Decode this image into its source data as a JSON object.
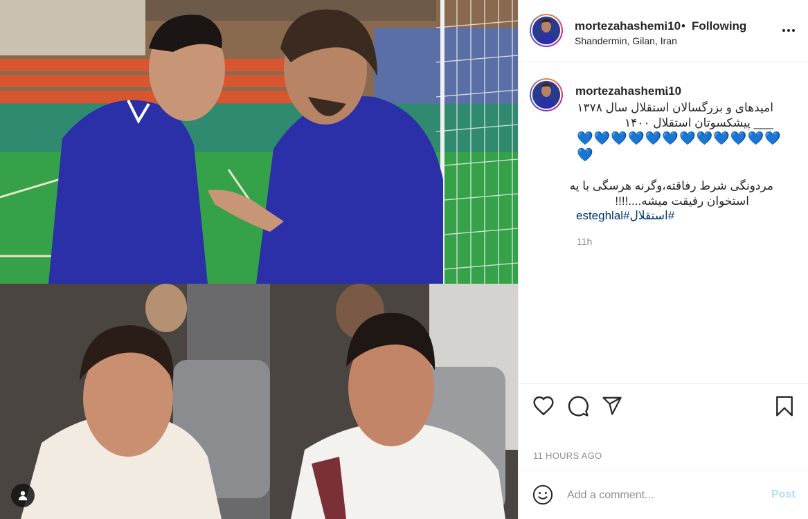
{
  "post": {
    "author": "mortezahashemi10",
    "follow_status": "Following",
    "separator": "•",
    "location": "Shandermin, Gilan, Iran"
  },
  "caption": {
    "username": "mortezahashemi10",
    "suffix": "..",
    "line1": "امیدهای و بزرگسالان استقلال سال ۱۳۷۸",
    "line2": "___ پیشکسوتان استقلال ۱۴۰۰",
    "hearts": "💙💙💙💙💙💙💙💙💙💙💙💙💙",
    "line3": "مردونگی شرط رفاقته،وگرنه هرسگی با یه",
    "line4": "استخوان رفیقت میشه....!!!!",
    "hashtags": "#استقلال#esteghlal",
    "time": "11h"
  },
  "actions": {
    "like_icon": "heart-icon",
    "comment_icon": "comment-icon",
    "share_icon": "send-icon",
    "save_icon": "bookmark-icon",
    "timestamp": "11 HOURS AGO"
  },
  "comment": {
    "placeholder": "Add a comment...",
    "post_label": "Post",
    "emoji_icon": "smiley-icon"
  },
  "colors": {
    "post_disabled": "#b2dffc",
    "hashtag": "#00376b",
    "secondary_text": "#8e8e8e",
    "jersey_blue": "#2b2fa8"
  }
}
